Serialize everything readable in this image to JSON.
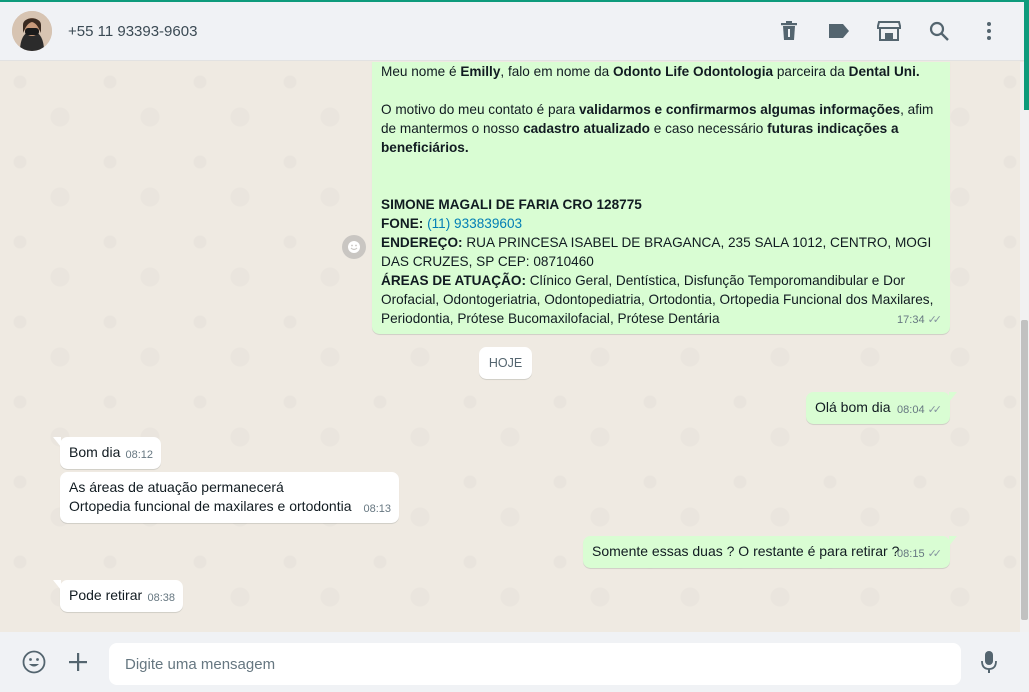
{
  "header": {
    "contact_name": "+55 11 93393-9603",
    "icons": [
      "delete-icon",
      "label-icon",
      "catalog-icon",
      "search-icon",
      "menu-icon"
    ]
  },
  "messages": {
    "m1": {
      "p1_a": "Meu nome é ",
      "p1_b": "Emilly",
      "p1_c": ", falo em nome da ",
      "p1_d": "Odonto Life Odontologia",
      "p1_e": " parceira da ",
      "p1_f": "Dental Uni.",
      "p2_a": "O motivo do meu contato é para ",
      "p2_b": "validarmos e confirmarmos algumas informações",
      "p2_c": ", afim de mantermos o nosso ",
      "p2_d": "cadastro atualizado",
      "p2_e": " e caso necessário ",
      "p2_f": "futuras indicações a beneficiários.",
      "name_line": "SIMONE MAGALI DE FARIA CRO 128775",
      "phone_label": "FONE:",
      "phone_value": "(11) 933839603",
      "address_label": "ENDEREÇO:",
      "address_value": "RUA PRINCESA ISABEL DE BRAGANCA, 235 SALA 1012, CENTRO, MOGI DAS CRUZES, SP CEP: 08710460",
      "areas_label": "ÁREAS DE ATUAÇÃO:",
      "areas_value": "Clínico Geral, Dentística, Disfunção Temporomandibular e Dor Orofacial, Odontogeriatria, Odontopediatria, Ortodontia, Ortopedia Funcional dos Maxilares, Periodontia, Prótese Bucomaxilofacial, Prótese Dentária",
      "time": "17:34"
    },
    "day_chip": "HOJE",
    "m2": {
      "text": "Olá bom dia",
      "time": "08:04"
    },
    "m3": {
      "text": "Bom dia",
      "time": "08:12"
    },
    "m4": {
      "line1": "As áreas de atuação permanecerá",
      "line2": "Ortopedia funcional de maxilares e ortodontia",
      "time": "08:13"
    },
    "m5": {
      "text": "Somente essas duas ? O restante é para retirar ?",
      "time": "08:15"
    },
    "m6": {
      "text": "Pode retirar",
      "time": "08:38"
    }
  },
  "footer": {
    "placeholder": "Digite uma mensagem",
    "icons": [
      "emoji-icon",
      "attach-icon",
      "microphone-icon"
    ]
  },
  "colors": {
    "outgoing_bubble": "#d9fdd3",
    "incoming_bubble": "#ffffff",
    "chat_background": "#efeae2",
    "accent": "#0e9b7c",
    "link": "#027eb5"
  }
}
